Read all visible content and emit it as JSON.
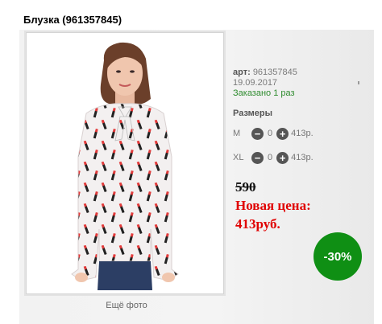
{
  "product": {
    "title": "Блузка (961357845)",
    "more_photos": "Ещё фото",
    "art_label": "арт:",
    "art_value": "961357845",
    "date": "19.09.2017",
    "ordered": "Заказано 1 раз",
    "sizes_title": "Размеры",
    "sizes": [
      {
        "name": "M",
        "qty": "0",
        "price": "413р."
      },
      {
        "name": "XL",
        "qty": "0",
        "price": "413р."
      }
    ],
    "old_price": "590",
    "new_price_label": "Новая цена:",
    "new_price": "413руб.",
    "discount": "-30%"
  },
  "icons": {
    "minus": "minus-icon",
    "plus": "plus-icon"
  },
  "colors": {
    "discount_bg": "#0f8f14",
    "price_red": "#e00000",
    "ordered_green": "#2e8b2e"
  }
}
